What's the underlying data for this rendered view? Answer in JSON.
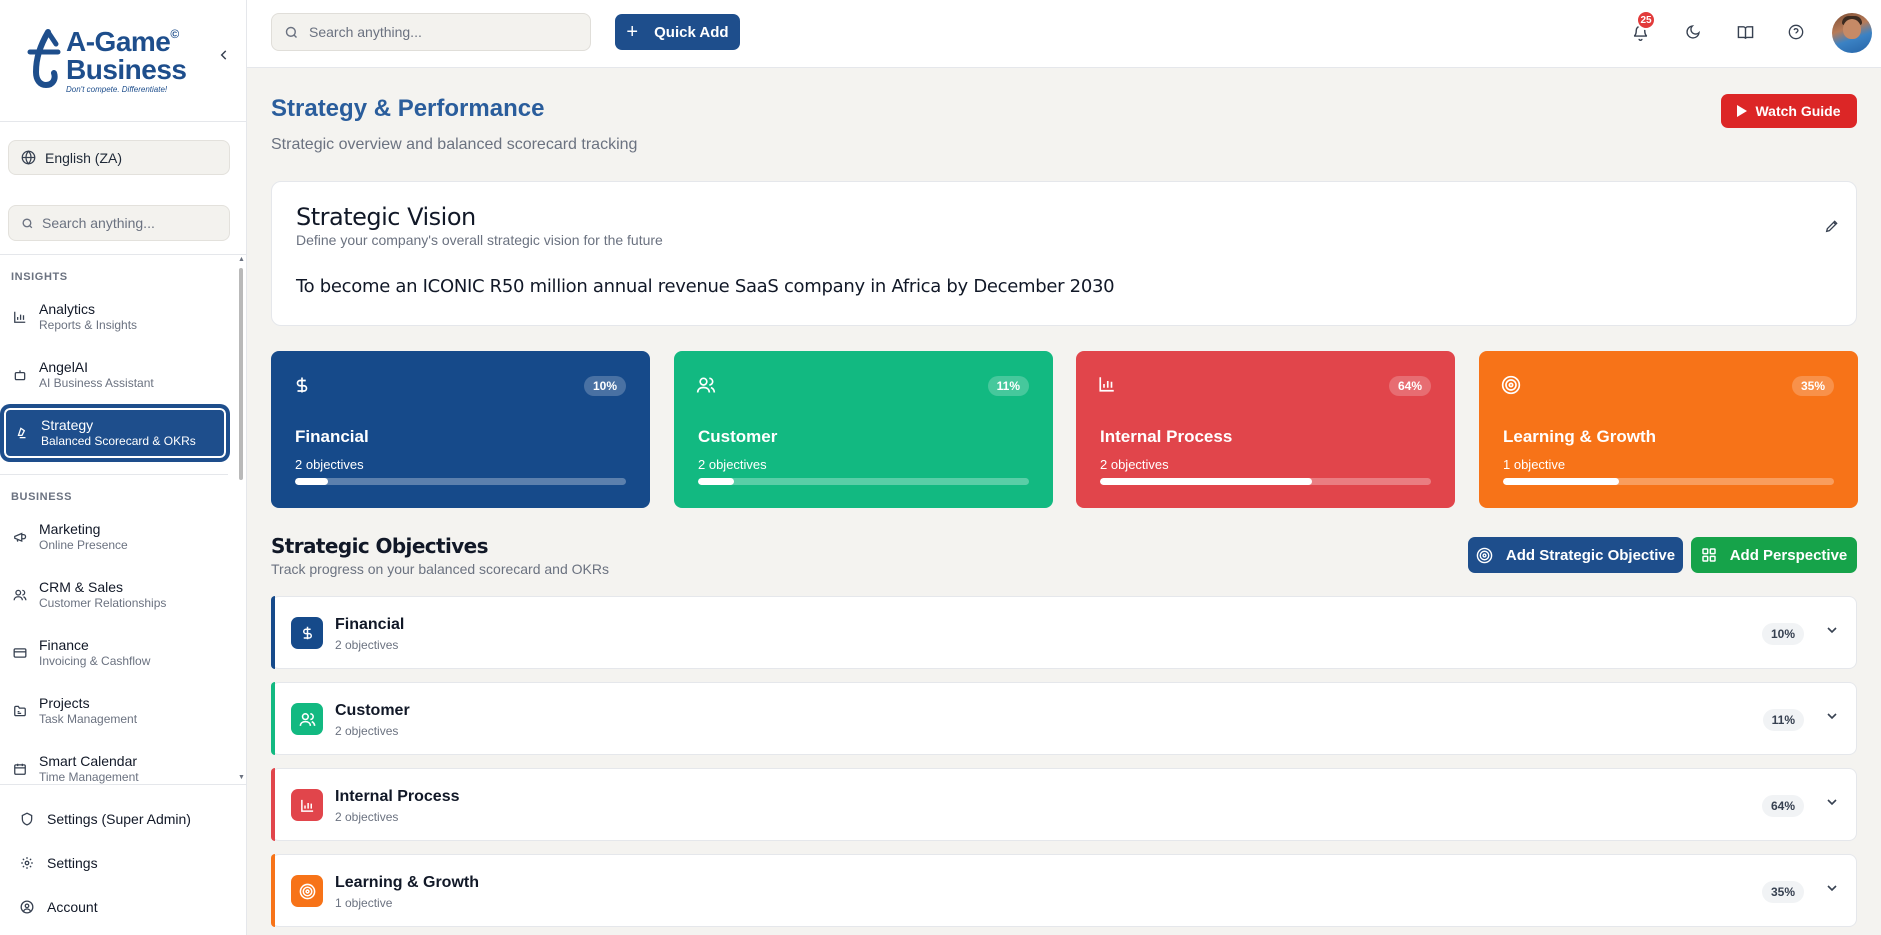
{
  "brand": {
    "line1": "A-Game",
    "line2": "Business",
    "copyright": "©",
    "tagline": "Don't compete. Differentiate!",
    "color": "#1e4e8c"
  },
  "sidebar": {
    "language": "English (ZA)",
    "search_placeholder": "Search anything...",
    "sections": [
      {
        "title": "INSIGHTS",
        "items": [
          {
            "label": "Analytics",
            "sub": "Reports & Insights",
            "icon": "bar-chart-icon"
          },
          {
            "label": "AngelAI",
            "sub": "AI Business Assistant",
            "icon": "bot-icon"
          },
          {
            "label": "Strategy",
            "sub": "Balanced Scorecard & OKRs",
            "icon": "strategy-icon",
            "active": true
          }
        ]
      },
      {
        "title": "BUSINESS",
        "items": [
          {
            "label": "Marketing",
            "sub": "Online Presence",
            "icon": "megaphone-icon"
          },
          {
            "label": "CRM & Sales",
            "sub": "Customer Relationships",
            "icon": "users-icon"
          },
          {
            "label": "Finance",
            "sub": "Invoicing & Cashflow",
            "icon": "credit-card-icon"
          },
          {
            "label": "Projects",
            "sub": "Task Management",
            "icon": "folder-icon"
          },
          {
            "label": "Smart Calendar",
            "sub": "Time Management",
            "icon": "calendar-icon"
          }
        ]
      }
    ],
    "bottom": [
      {
        "label": "Settings (Super Admin)",
        "icon": "shield-icon"
      },
      {
        "label": "Settings",
        "icon": "gear-icon"
      },
      {
        "label": "Account",
        "icon": "user-circle-icon"
      }
    ]
  },
  "topbar": {
    "search_placeholder": "Search anything...",
    "quick_add_label": "Quick Add",
    "notification_count": "25",
    "icons": [
      "bell-icon",
      "moon-icon",
      "book-icon",
      "help-icon"
    ]
  },
  "page": {
    "title": "Strategy & Performance",
    "subtitle": "Strategic overview and balanced scorecard tracking",
    "watch_guide_label": "Watch Guide"
  },
  "vision": {
    "title": "Strategic Vision",
    "subtitle": "Define your company's overall strategic vision for the future",
    "text": "To become an ICONIC R50 million annual revenue SaaS company in Africa by December 2030"
  },
  "perspectives": [
    {
      "name": "Financial",
      "objectives": "2 objectives",
      "percent_label": "10%",
      "progress": 0.1,
      "color": "#164a8a",
      "icon": "dollar-icon"
    },
    {
      "name": "Customer",
      "objectives": "2 objectives",
      "percent_label": "11%",
      "progress": 0.11,
      "color": "#12b981",
      "icon": "users-icon"
    },
    {
      "name": "Internal Process",
      "objectives": "2 objectives",
      "percent_label": "64%",
      "progress": 0.64,
      "color": "#e1454b",
      "icon": "bar-chart-icon"
    },
    {
      "name": "Learning & Growth",
      "objectives": "1 objective",
      "percent_label": "35%",
      "progress": 0.35,
      "color": "#f77318",
      "icon": "target-icon"
    }
  ],
  "objectives_section": {
    "title": "Strategic Objectives",
    "subtitle": "Track progress on your balanced scorecard and OKRs",
    "add_objective_label": "Add Strategic Objective",
    "add_perspective_label": "Add Perspective",
    "add_objective_color": "#1e4e8c",
    "add_perspective_color": "#16a34a"
  }
}
